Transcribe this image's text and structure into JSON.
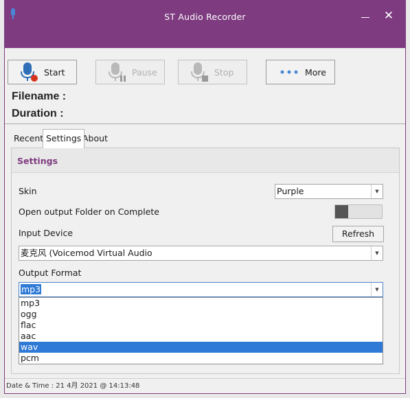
{
  "window": {
    "title": "ST Audio Recorder",
    "close_glyph": "✕",
    "accent": "#7e3b80"
  },
  "toolbar": {
    "start_label": "Start",
    "pause_label": "Pause",
    "stop_label": "Stop",
    "more_label": "More"
  },
  "info": {
    "filename_label": "Filename :",
    "duration_label": "Duration :"
  },
  "tabs": [
    {
      "label": "Recent"
    },
    {
      "label": "Settings"
    },
    {
      "label": "About"
    }
  ],
  "settings": {
    "header": "Settings",
    "skin_label": "Skin",
    "skin_value": "Purple",
    "open_folder_label": "Open output Folder on Complete",
    "input_device_label": "Input Device",
    "refresh_label": "Refresh",
    "input_device_value": "麦克风 (Voicemod Virtual Audio",
    "output_format_label": "Output Format",
    "output_format_value": "mp3",
    "format_options": [
      "mp3",
      "ogg",
      "flac",
      "aac",
      "wav",
      "pcm"
    ],
    "highlighted_option": "wav"
  },
  "status": {
    "datetime": "Date & Time : 21 4月 2021 @ 14:13:48"
  },
  "icons": {
    "app": "microphone-icon",
    "start": "microphone-record-icon",
    "pause": "microphone-pause-icon",
    "stop": "microphone-stop-icon",
    "more": "ellipsis-icon"
  }
}
